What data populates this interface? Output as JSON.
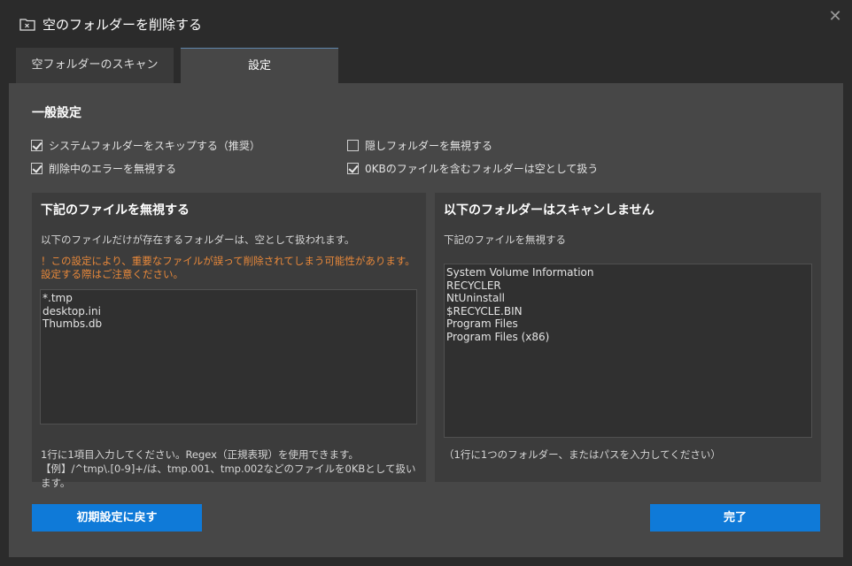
{
  "window": {
    "title": "空のフォルダーを削除する",
    "title_icon": "folder-delete-icon",
    "close_glyph": "✕"
  },
  "tabs": [
    {
      "label": "空フォルダーのスキャン",
      "active": false
    },
    {
      "label": "設定",
      "active": true
    }
  ],
  "general": {
    "title": "一般設定",
    "options": [
      {
        "label": "システムフォルダーをスキップする（推奨）",
        "checked": true
      },
      {
        "label": "削除中のエラーを無視する",
        "checked": true
      },
      {
        "label": "隠しフォルダーを無視する",
        "checked": false
      },
      {
        "label": "0KBのファイルを含むフォルダーは空として扱う",
        "checked": true
      }
    ]
  },
  "ignore_files": {
    "title": "下記のファイルを無視する",
    "desc": "以下のファイルだけが存在するフォルダーは、空として扱われます。",
    "warning": "！この設定により、重要なファイルが誤って削除されてしまう可能性があります。設定する際はご注意ください。",
    "items": [
      "*.tmp",
      "desktop.ini",
      "Thumbs.db"
    ],
    "footer": "1行に1項目入力してください。Regex（正規表現）を使用できます。【例】/^tmp\\.[0-9]+/は、tmp.001、tmp.002などのファイルを0KBとして扱います。"
  },
  "skip_folders": {
    "title": "以下のフォルダーはスキャンしません",
    "desc": "下記のファイルを無視する",
    "items": [
      "System Volume Information",
      "RECYCLER",
      "NtUninstall",
      "$RECYCLE.BIN",
      "Program Files",
      "Program Files (x86)"
    ],
    "footer": "（1行に1つのフォルダー、またはパスを入力してください）"
  },
  "buttons": {
    "reset": "初期設定に戻す",
    "done": "完了"
  },
  "colors": {
    "accent": "#0f7ad8",
    "warning": "#e8883a",
    "background": "#2b2b2b",
    "panel": "#474747"
  }
}
